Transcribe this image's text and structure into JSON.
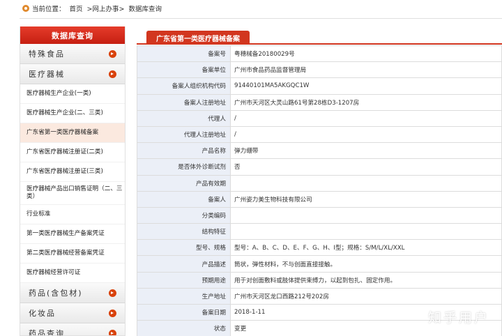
{
  "breadcrumb": {
    "lead": "当前位置：",
    "items": [
      "首页",
      ">网上办事>",
      "数据库查询"
    ]
  },
  "sidebar": {
    "title": "数据库查询",
    "top_cats": [
      {
        "label": "特殊食品"
      },
      {
        "label": "医疗器械"
      }
    ],
    "items": [
      {
        "label": "医疗器械生产企业(一类)"
      },
      {
        "label": "医疗器械生产企业(二、三类)"
      },
      {
        "label": "广东省第一类医疗器械备案"
      },
      {
        "label": "广东省医疗器械注册证(二类)"
      },
      {
        "label": "广东省医疗器械注册证(三类)"
      },
      {
        "label": "医疗器械产品出口销售证明（二、三类）"
      },
      {
        "label": "行业标准"
      },
      {
        "label": "第一类医疗器械生产备案凭证"
      },
      {
        "label": "第二类医疗器械经营备案凭证"
      },
      {
        "label": "医疗器械经营许可证"
      }
    ],
    "bottom_cats": [
      {
        "label": "药品(含包材)"
      },
      {
        "label": "化妆品"
      },
      {
        "label": "药品查询"
      }
    ]
  },
  "main": {
    "tab_title": "广东省第一类医疗器械备案",
    "rows": [
      {
        "label": "备案号",
        "value": "粤穗械备20180029号"
      },
      {
        "label": "备案单位",
        "value": "广州市食品药品监督管理局"
      },
      {
        "label": "备案人组织机构代码",
        "value": "91440101MA5AKGQC1W"
      },
      {
        "label": "备案人注册地址",
        "value": "广州市天河区大灵山路61号第28栋D3-1207房"
      },
      {
        "label": "代理人",
        "value": "/"
      },
      {
        "label": "代理人注册地址",
        "value": "/"
      },
      {
        "label": "产品名称",
        "value": "弹力绷带"
      },
      {
        "label": "是否体外诊断试剂",
        "value": "否"
      },
      {
        "label": "产品有效期",
        "value": ""
      },
      {
        "label": "备案人",
        "value": "广州姿力美生物科技有限公司"
      },
      {
        "label": "分类编码",
        "value": ""
      },
      {
        "label": "结构特征",
        "value": ""
      },
      {
        "label": "型号、规格",
        "value": "型号：A、B、C、D、E、F、G、H、I型；规格：S/M/L/XL/XXL"
      },
      {
        "label": "产品描述",
        "value": "筒状，弹性材料，不与创面直接接触。"
      },
      {
        "label": "预期用途",
        "value": "用于对创面敷料或肢体提供束缚力，以起到包扎、固定作用。"
      },
      {
        "label": "生产地址",
        "value": "广州市天河区龙口西路212号202房"
      },
      {
        "label": "备案日期",
        "value": "2018-1-11"
      },
      {
        "label": "状态",
        "value": "变更"
      }
    ]
  },
  "watermark": "知乎用户",
  "colors": {
    "accent": "#d2361f",
    "label_bg": "#ebeff7",
    "active_bg": "#fbe9df"
  }
}
